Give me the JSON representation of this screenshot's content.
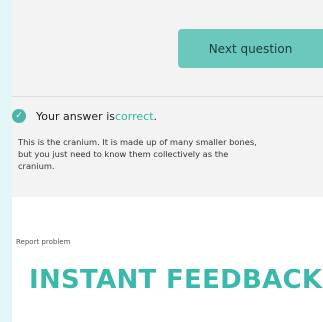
{
  "buttons": {
    "next_label": "Next question"
  },
  "feedback": {
    "prefix": "Your answer is ",
    "result": "correct",
    "suffix": ".",
    "explanation": "This is the cranium. It is made up of many smaller bones,\nbut you just need to know them collectively as the\ncranium."
  },
  "links": {
    "report": "Report problem"
  },
  "heading": "INSTANT FEEDBACK",
  "icons": {
    "feedback_status": "check-circle"
  },
  "colors": {
    "accent": "#6bc8bd",
    "correct": "#31b7a1",
    "heading": "#38b9ab"
  }
}
